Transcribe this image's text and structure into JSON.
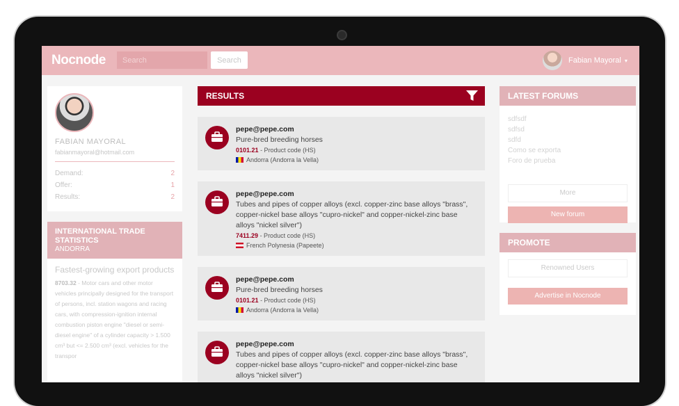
{
  "app": {
    "logo": "Nocnode"
  },
  "search": {
    "placeholder": "Search",
    "button_label": "Search"
  },
  "user": {
    "name": "Fabian Mayoral",
    "caret": "▾"
  },
  "profile": {
    "name": "FABIAN MAYORAL",
    "email": "fabianmayoral@hotmail.com",
    "stats": [
      {
        "label": "Demand:",
        "value": "2"
      },
      {
        "label": "Offer:",
        "value": "1"
      },
      {
        "label": "Results:",
        "value": "2"
      }
    ]
  },
  "trade": {
    "title": "INTERNATIONAL TRADE STATISTICS",
    "country": "ANDORRA"
  },
  "export": {
    "title": "Fastest-growing export products",
    "code": "8703.32",
    "text": " - Motor cars and other motor vehicles principally designed for the transport of persons, incl. station wagons and racing cars, with compression-ignition internal combustion piston engine \"diesel or semi-diesel engine\" of a cylinder capacity > 1.500 cm³ but <= 2.500 cm³ (excl. vehicles for the transpor"
  },
  "results": {
    "title": "RESULTS",
    "items": [
      {
        "email": "pepe@pepe.com",
        "description": "Pure-bred breeding horses",
        "code": "0101.21",
        "code_label": "- Product code (HS)",
        "country": "Andorra (Andorra la Vella)",
        "flag": "ad"
      },
      {
        "email": "pepe@pepe.com",
        "description": "Tubes and pipes of copper alloys (excl. copper-zinc base alloys \"brass\", copper-nickel base alloys \"cupro-nickel\" and copper-nickel-zinc base alloys \"nickel silver\")",
        "code": "7411.29",
        "code_label": "- Product code (HS)",
        "country": "French Polynesia (Papeete)",
        "flag": "pf"
      },
      {
        "email": "pepe@pepe.com",
        "description": "Pure-bred breeding horses",
        "code": "0101.21",
        "code_label": "- Product code (HS)",
        "country": "Andorra (Andorra la Vella)",
        "flag": "ad"
      },
      {
        "email": "pepe@pepe.com",
        "description": "Tubes and pipes of copper alloys (excl. copper-zinc base alloys \"brass\", copper-nickel base alloys \"cupro-nickel\" and copper-nickel-zinc base alloys \"nickel silver\")",
        "code": "",
        "code_label": "",
        "country": "",
        "flag": ""
      }
    ]
  },
  "forums": {
    "title": "LATEST FORUMS",
    "items": [
      "sdfsdf",
      "sdfsd",
      "sdfd",
      "Como se exporta",
      "Foro de prueba"
    ],
    "more_label": "More",
    "new_label": "New forum"
  },
  "promote": {
    "title": "PROMOTE",
    "renowned_label": "Renowned Users",
    "advertise_label": "Advertise in Nocnode"
  },
  "colors": {
    "brand": "#ebb7bb",
    "accent": "#9b0120",
    "pink_button": "#edb4b2"
  }
}
